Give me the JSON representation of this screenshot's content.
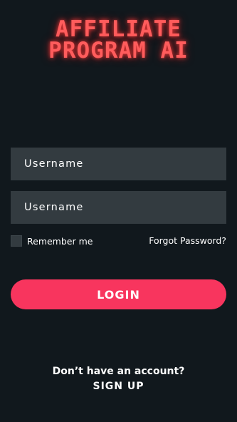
{
  "logo": {
    "line1": "AFFILIATE",
    "line2": "PROGRAM AI"
  },
  "form": {
    "username_placeholder": "Username",
    "second_placeholder": "Username",
    "remember_label": "Remember me",
    "forgot_label": "Forgot Password?",
    "login_label": "LOGIN"
  },
  "footer": {
    "no_account_text": "Don’t have an account?",
    "signup_label": "SIGN UP"
  },
  "colors": {
    "background": "#11181d",
    "field": "#333b40",
    "accent": "#f8355e",
    "logo": "#ff5c5c"
  }
}
